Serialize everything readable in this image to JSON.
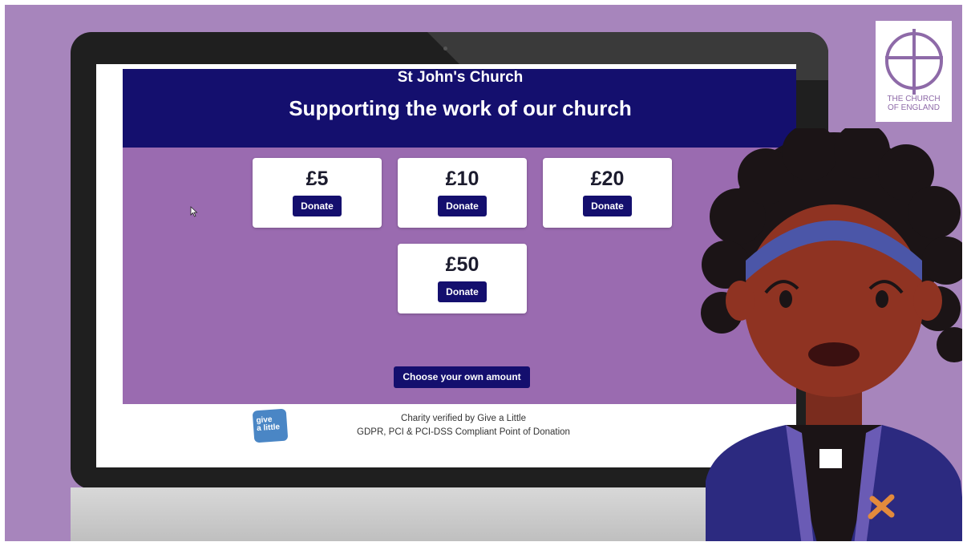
{
  "page": {
    "church_name": "St John's Church",
    "headline": "Supporting the work of our church"
  },
  "donation_options": [
    {
      "amount": "£5",
      "button": "Donate"
    },
    {
      "amount": "£10",
      "button": "Donate"
    },
    {
      "amount": "£20",
      "button": "Donate"
    },
    {
      "amount": "£50",
      "button": "Donate"
    }
  ],
  "own_amount_label": "Choose your own amount",
  "footer": {
    "line1": "Charity verified by Give a Little",
    "line2": "GDPR, PCI & PCI-DSS Compliant Point of Donation",
    "logo_text_top": "give",
    "logo_text_bottom": "a little"
  },
  "brand": {
    "logo_line1": "THE CHURCH",
    "logo_line2": "OF ENGLAND"
  },
  "colors": {
    "background": "#a785bc",
    "banner": "#140f6e",
    "donate_area": "#9a6bb0",
    "button": "#140f6e"
  },
  "icons": [
    "cursor-arrow-icon",
    "church-of-england-cross-logo"
  ]
}
